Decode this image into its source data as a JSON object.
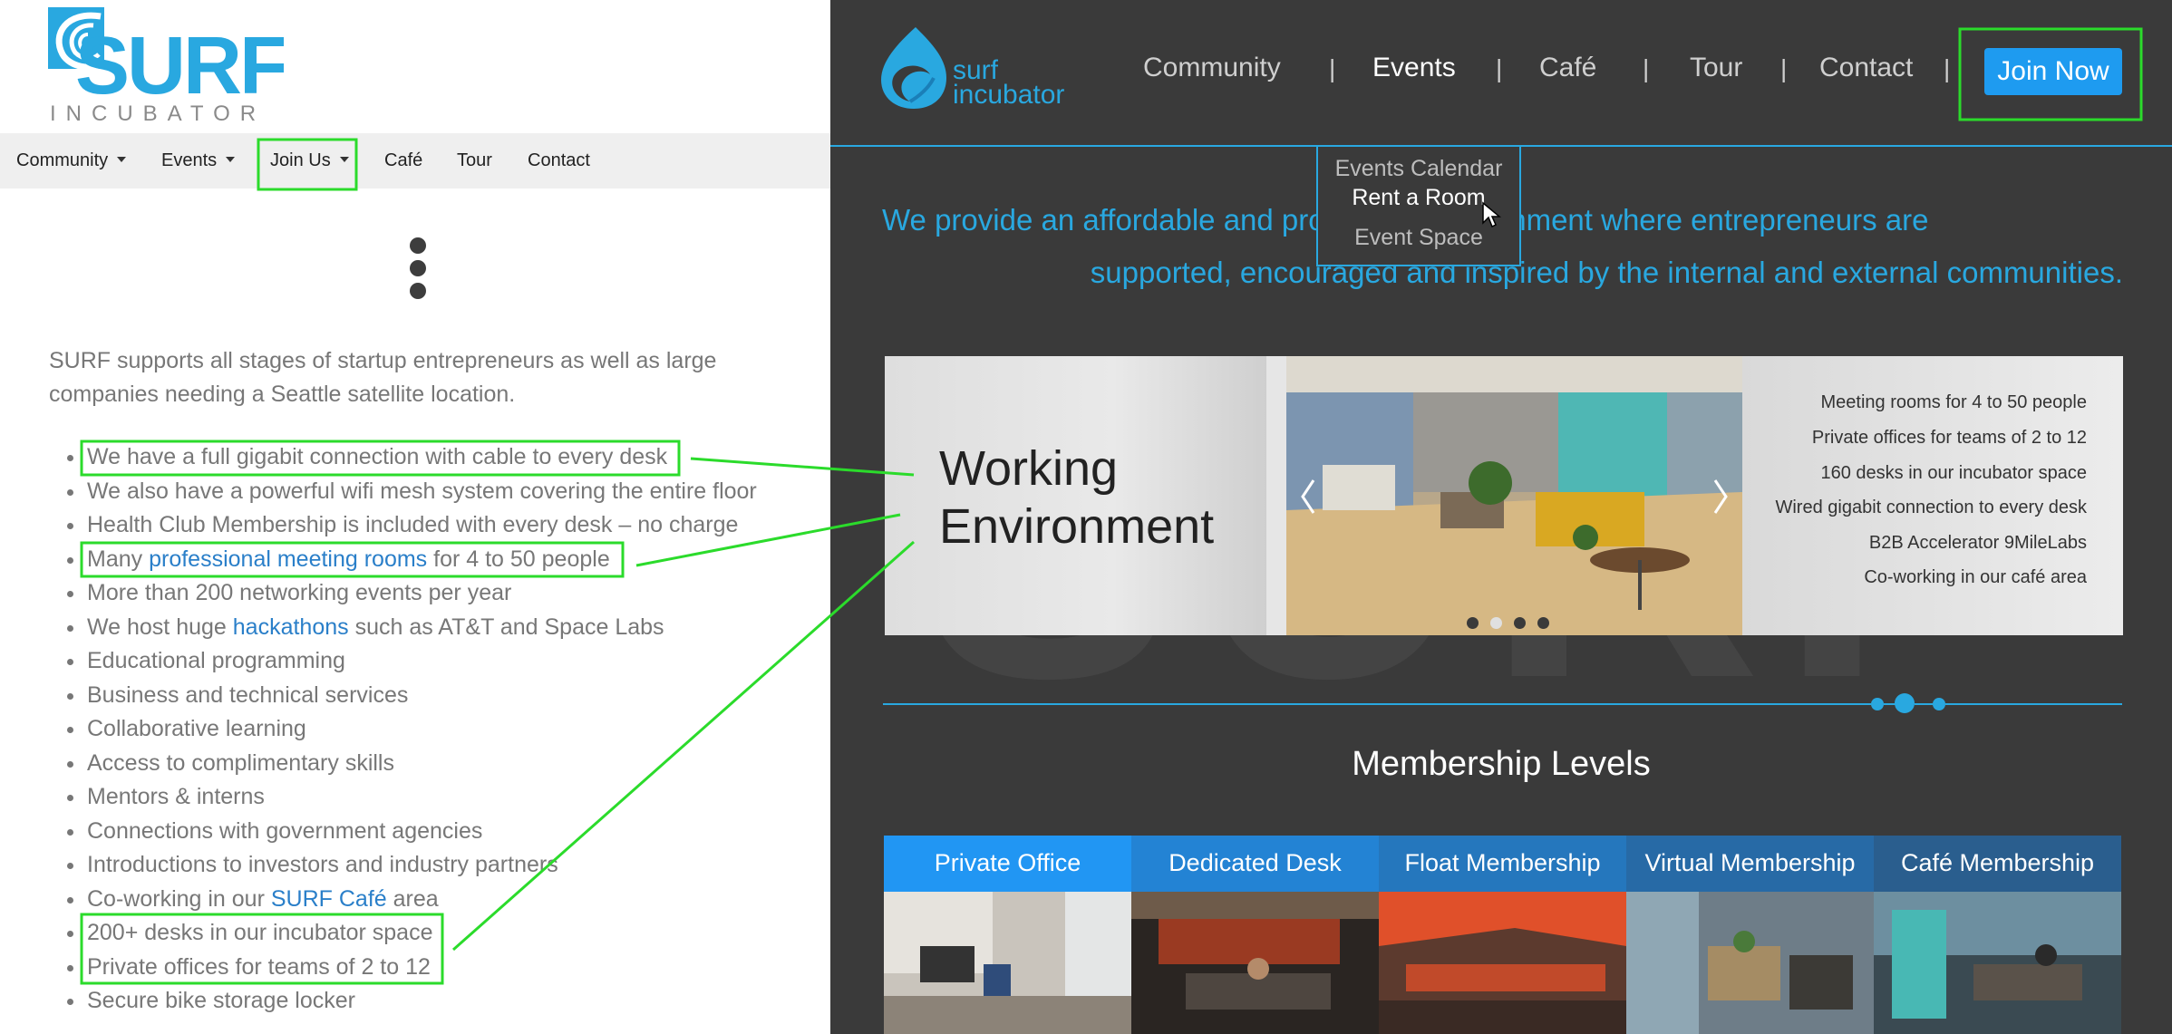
{
  "old_site": {
    "logo": {
      "wordmark": "SURF",
      "subtitle": "INCUBATOR"
    },
    "nav": [
      {
        "label": "Community",
        "dropdown": true
      },
      {
        "label": "Events",
        "dropdown": true
      },
      {
        "label": "Join Us",
        "dropdown": true
      },
      {
        "label": "Café",
        "dropdown": false
      },
      {
        "label": "Tour",
        "dropdown": false
      },
      {
        "label": "Contact",
        "dropdown": false
      }
    ],
    "intro": "SURF supports all stages of startup entrepreneurs as well as large companies needing a Seattle satellite location.",
    "list": [
      {
        "pre": "We have a full gigabit connection with cable to every desk"
      },
      {
        "pre": "We also have a powerful wifi mesh system covering the entire floor"
      },
      {
        "pre": "Health Club Membership is included with every desk – no charge"
      },
      {
        "pre": "Many ",
        "link": "professional meeting rooms",
        "post": " for 4 to 50 people"
      },
      {
        "pre": "More than 200 networking events per year"
      },
      {
        "pre": "We host huge ",
        "link": "hackathons",
        "post": " such as AT&T and Space Labs"
      },
      {
        "pre": "Educational programming"
      },
      {
        "pre": "Business and technical services"
      },
      {
        "pre": "Collaborative learning"
      },
      {
        "pre": "Access to complimentary skills"
      },
      {
        "pre": "Mentors & interns"
      },
      {
        "pre": "Connections with government agencies"
      },
      {
        "pre": "Introductions to investors and industry partners"
      },
      {
        "pre": "Co-working in our ",
        "link": "SURF Café",
        "post": " area"
      },
      {
        "pre": "200+ desks in our incubator space"
      },
      {
        "pre": "Private offices for teams of 2 to 12"
      },
      {
        "pre": "Secure bike storage locker"
      }
    ]
  },
  "new_site": {
    "logo": {
      "line1": "surf",
      "line2": "incubator"
    },
    "nav": [
      "Community",
      "Events",
      "Café",
      "Tour",
      "Contact"
    ],
    "separator": "|",
    "cta": "Join Now",
    "dropdown": [
      "Events Calendar",
      "Rent a Room",
      "Event Space"
    ],
    "tagline_line1": "We provide an affordable and productive environment where entrepreneurs are",
    "tagline_line2": "supported, encouraged and inspired by the internal and external communities.",
    "slider": {
      "title_line1": "Working",
      "title_line2": "Environment",
      "features": [
        "Meeting rooms for 4 to 50 people",
        "Private offices for teams of 2 to 12",
        "160 desks in our incubator space",
        "Wired gigabit connection to every desk",
        "B2B Accelerator 9MileLabs",
        "Co-working in our café area"
      ],
      "active_dot": 2
    },
    "membership_heading": "Membership Levels",
    "membership": [
      {
        "label": "Private Office",
        "color": "#2196f3"
      },
      {
        "label": "Dedicated Desk",
        "color": "#2383d4"
      },
      {
        "label": "Float Membership",
        "color": "#2577bd"
      },
      {
        "label": "Virtual Membership",
        "color": "#276aa6"
      },
      {
        "label": "Café Membership",
        "color": "#2a5e8e"
      }
    ]
  },
  "colors": {
    "accent": "#29a8e0",
    "highlight": "#2bdb2b",
    "cta": "#1e9bf0",
    "link": "#2a7fc9"
  }
}
